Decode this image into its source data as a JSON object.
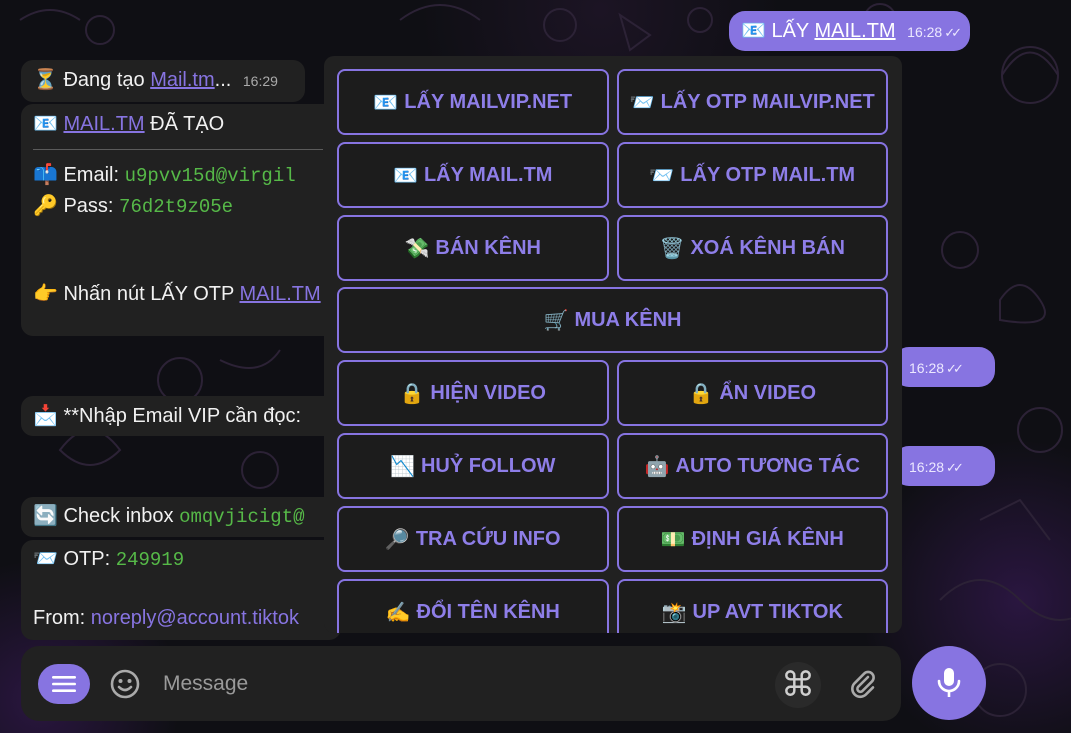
{
  "outgoing": {
    "m1": {
      "icon": "📧",
      "prefix": "LẤY ",
      "link": "MAIL.TM",
      "time": "16:28"
    },
    "m2": {
      "time": "16:28"
    },
    "m3": {
      "time": "16:28"
    }
  },
  "incoming": {
    "creating": {
      "icon": "⏳",
      "text": "Đang tạo ",
      "link": "Mail.tm",
      "ellipsis": "...",
      "time": "16:29"
    },
    "created": {
      "icon": "📧",
      "link": "MAIL.TM",
      "title_suffix": " ĐÃ TẠO",
      "email_icon": "📫",
      "email_label": "Email: ",
      "email_value": "u9pvv15d@virgil",
      "pass_icon": "🔑",
      "pass_label": "Pass: ",
      "pass_value": "76d2t9z05e",
      "hint_icon": "👉",
      "hint_text": "Nhấn nút LẤY OTP ",
      "hint_link": "MAIL.TM"
    },
    "vip": {
      "icon": "📩",
      "text": "**Nhập Email VIP cần đọc:"
    },
    "check": {
      "icon": "🔄",
      "text": "Check inbox ",
      "value": "omqvjicigt@"
    },
    "otp": {
      "icon": "📨",
      "label": "OTP: ",
      "value": "249919",
      "from_label": "From: ",
      "from_value": "noreply@account.tiktok"
    }
  },
  "keyboard": {
    "rows": [
      [
        {
          "icon": "📧",
          "label": "LẤY MAILVIP.NET"
        },
        {
          "icon": "📨",
          "label": "LẤY OTP MAILVIP.NET"
        }
      ],
      [
        {
          "icon": "📧",
          "label": "LẤY MAIL.TM"
        },
        {
          "icon": "📨",
          "label": "LẤY OTP MAIL.TM"
        }
      ],
      [
        {
          "icon": "💸",
          "label": "BÁN KÊNH"
        },
        {
          "icon": "🗑️",
          "label": "XOÁ KÊNH BÁN"
        }
      ],
      [
        {
          "icon": "🛒",
          "label": "MUA KÊNH"
        }
      ],
      [
        {
          "icon": "🔒",
          "label": "HIỆN VIDEO"
        },
        {
          "icon": "🔒",
          "label": "ẨN VIDEO"
        }
      ],
      [
        {
          "icon": "📉",
          "label": "HUỶ FOLLOW"
        },
        {
          "icon": "🤖",
          "label": "AUTO TƯƠNG TÁC"
        }
      ],
      [
        {
          "icon": "🔎",
          "label": "TRA CỨU INFO"
        },
        {
          "icon": "💵",
          "label": "ĐỊNH GIÁ KÊNH"
        }
      ],
      [
        {
          "icon": "✍️",
          "label": "ĐỔI TÊN KÊNH"
        },
        {
          "icon": "📸",
          "label": "UP AVT TIKTOK"
        }
      ]
    ]
  },
  "composer": {
    "placeholder": "Message",
    "menu_icon": "menu-icon",
    "emoji_icon": "smile-icon",
    "command_icon": "⌘",
    "attach_icon": "paperclip-icon",
    "mic_icon": "microphone-icon"
  },
  "colors": {
    "accent": "#8774e1",
    "bubble": "#212121",
    "code": "#56b948",
    "background": "#0f0f14"
  }
}
